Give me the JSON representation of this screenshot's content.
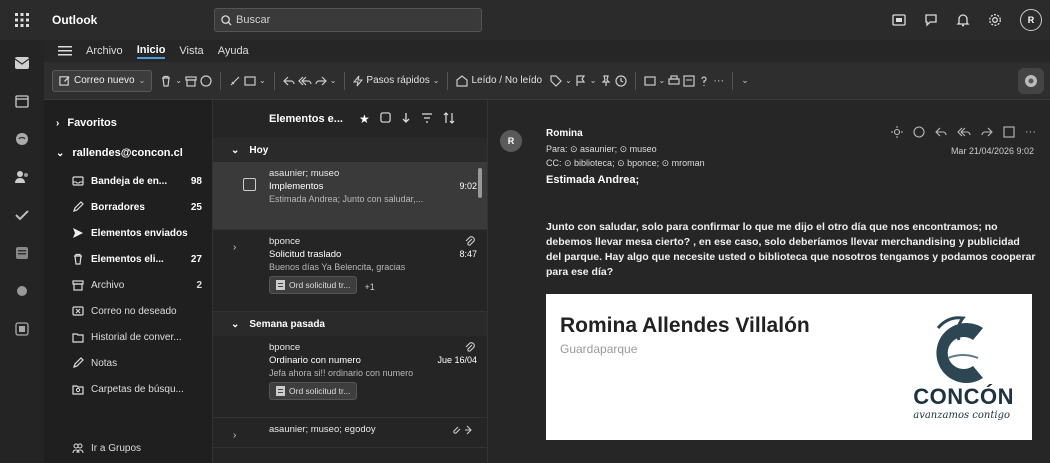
{
  "app": {
    "title": "Outlook",
    "avatar_initials": "R"
  },
  "search": {
    "placeholder": "Buscar"
  },
  "menu": {
    "items": [
      "Archivo",
      "Inicio",
      "Vista",
      "Ayuda"
    ],
    "active": "Inicio"
  },
  "ribbon": {
    "new_mail": "Correo nuevo",
    "quick_steps": "Pasos rápidos",
    "read_unread": "Leído / No leído"
  },
  "folders": {
    "favorites": "Favoritos",
    "account": "rallendes@concon.cl",
    "items": [
      {
        "label": "Bandeja de en...",
        "count": "98",
        "icon": "inbox-icon"
      },
      {
        "label": "Borradores",
        "count": "25",
        "icon": "drafts-icon"
      },
      {
        "label": "Elementos enviados",
        "count": "",
        "icon": "sent-icon"
      },
      {
        "label": "Elementos eli...",
        "count": "27",
        "icon": "deleted-icon"
      },
      {
        "label": "Archivo",
        "count": "2",
        "icon": "archive-icon"
      },
      {
        "label": "Correo no deseado",
        "count": "",
        "icon": "junk-icon"
      },
      {
        "label": "Historial de conver...",
        "count": "",
        "icon": "history-icon"
      },
      {
        "label": "Notas",
        "count": "",
        "icon": "notes-icon"
      },
      {
        "label": "Carpetas de búsqu...",
        "count": "",
        "icon": "search-folder-icon"
      }
    ],
    "groups": "Ir a Grupos"
  },
  "message_list": {
    "title": "Elementos e...",
    "sections": [
      {
        "label": "Hoy",
        "messages": [
          {
            "from": "asaunier; museo",
            "subject": "Implementos",
            "time": "9:02",
            "preview": "Estimada Andrea; Junto con saludar,...",
            "attachment": "",
            "more": ""
          },
          {
            "from": "bponce",
            "subject": "Solicitud traslado",
            "time": "8:47",
            "preview": "Buenos días Ya Belencita, gracias",
            "attachment": "Ord solicitud tr...",
            "more": "+1"
          }
        ]
      },
      {
        "label": "Semana pasada",
        "messages": [
          {
            "from": "bponce",
            "subject": "Ordinario con numero",
            "time": "Jue 16/04",
            "preview": "Jefa ahora si!! ordinario con numero",
            "attachment": "Ord solicitud tr...",
            "more": ""
          },
          {
            "from": "asaunier; museo; egodoy",
            "subject": "",
            "time": "",
            "preview": "",
            "attachment": "",
            "more": ""
          }
        ]
      }
    ]
  },
  "reading": {
    "avatar": "R",
    "sender": "Romina",
    "to": "Para: ⊙ asaunier; ⊙ museo",
    "cc": "CC: ⊙ biblioteca; ⊙ bponce; ⊙ mroman",
    "date": "Mar 21/04/2026 9:02",
    "greeting": "Estimada Andrea;",
    "body": "Junto con saludar, solo para confirmar lo que me dijo el otro día que nos encontramos; no debemos llevar mesa cierto? , en ese caso, solo deberíamos llevar merchandising y publicidad del parque. Hay algo que necesite usted o biblioteca que nosotros tengamos y podamos cooperar para ese día?",
    "signature": {
      "name": "Romina Allendes Villalón",
      "role": "Guardaparque",
      "logo_text": "CONCÓN",
      "logo_sub": "avanzamos contigo"
    }
  },
  "colors": {
    "accent": "#4f9bd9",
    "background": "#1a1a1a"
  }
}
